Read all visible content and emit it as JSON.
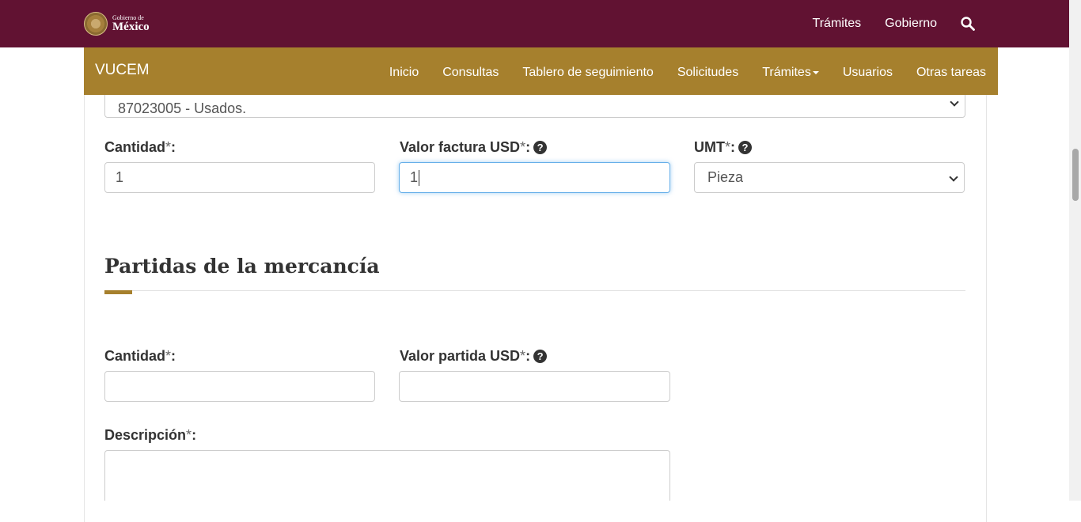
{
  "gov_header": {
    "logo_small": "Gobierno de",
    "logo_big": "México",
    "nav": [
      "Trámites",
      "Gobierno"
    ],
    "search_icon": "search-icon"
  },
  "vucem_nav": {
    "brand": "VUCEM",
    "items": [
      "Inicio",
      "Consultas",
      "Tablero de seguimiento",
      "Solicitudes",
      "Trámites",
      "Usuarios",
      "Otras tareas"
    ]
  },
  "form": {
    "fraccion_select_value": "87023005 - Usados.",
    "cantidad": {
      "label": "Cantidad",
      "required_mark": "*",
      "colon": ":",
      "value": "1"
    },
    "valor_factura": {
      "label": "Valor factura USD",
      "required_mark": "*",
      "colon": ":",
      "value": "1",
      "help": "?"
    },
    "umt": {
      "label": "UMT",
      "required_mark": "*",
      "colon": ":",
      "value": "Pieza",
      "help": "?"
    }
  },
  "partidas": {
    "title": "Partidas de la mercancía",
    "cantidad": {
      "label": "Cantidad",
      "required_mark": "*",
      "colon": ":",
      "value": ""
    },
    "valor_partida": {
      "label": "Valor partida USD",
      "required_mark": "*",
      "colon": ":",
      "value": "",
      "help": "?"
    },
    "descripcion": {
      "label": "Descripción",
      "required_mark": "*",
      "colon": ":",
      "value": ""
    }
  },
  "colors": {
    "gov_bar": "#611232",
    "vucem_bar": "#a6802d",
    "focus": "#66afe9"
  }
}
